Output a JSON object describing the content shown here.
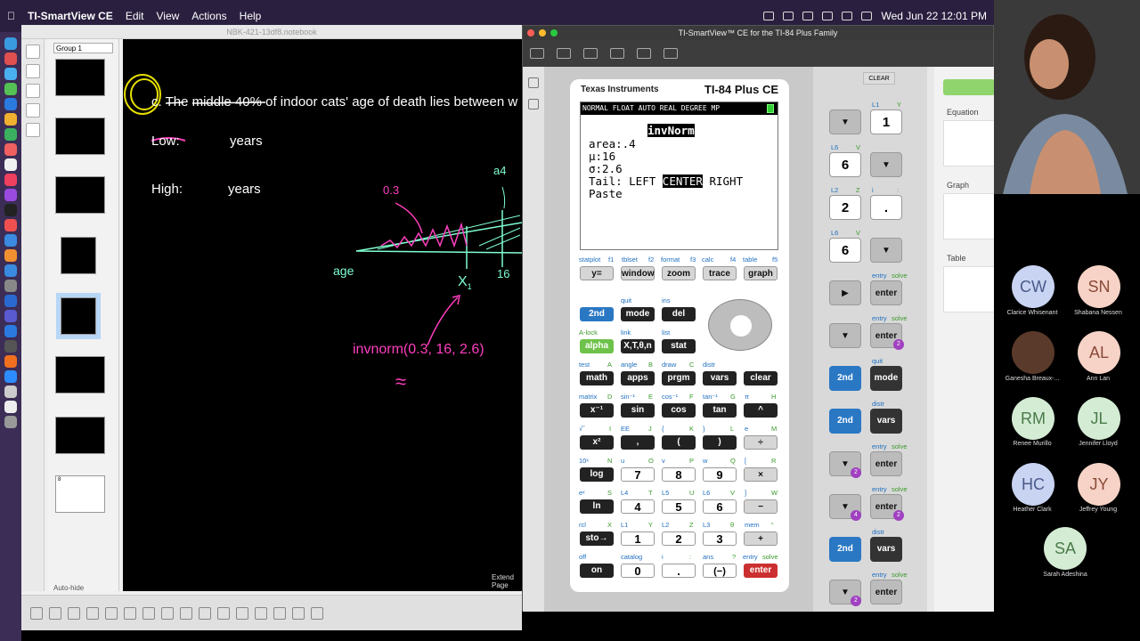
{
  "menubar": {
    "app_name": "TI-SmartView CE",
    "menus": [
      "Edit",
      "View",
      "Actions",
      "Help"
    ],
    "datetime": "Wed Jun 22  12:01 PM"
  },
  "notebook": {
    "title": "NBK-421-13df8.notebook",
    "group": "Group 1",
    "thumb_numbers": [
      "8"
    ],
    "auto_hide": "Auto-hide",
    "question": "c. The middle 40% of indoor cats' age of death lies between w",
    "low_label": "Low:",
    "high_label": "High:",
    "years": "years",
    "extend_page": "Extend Page",
    "handwriting": {
      "a03": "0.3",
      "a04": "a4",
      "age": "age",
      "x1": "X",
      "x1_sub": "1",
      "sixteen": "16",
      "invnorm": "invnorm(0.3, 16, 2.6)",
      "approx": "≈"
    }
  },
  "ti": {
    "window_title": "TI-SmartView™ CE for the TI-84 Plus Family",
    "brand": "Texas Instruments",
    "model": "TI-84 Plus CE",
    "status_bar": "NORMAL FLOAT AUTO REAL DEGREE MP",
    "screen": {
      "title": "invNorm",
      "area": "area:.4",
      "mu": "μ:16",
      "sigma": "σ:2.6",
      "tail_prefix": "Tail: LEFT ",
      "tail_center": "CENTER",
      "tail_suffix": " RIGHT",
      "paste": "Paste"
    },
    "function_labels": [
      "statplot",
      "f1",
      "tblset",
      "f2",
      "format",
      "f3",
      "calc",
      "f4",
      "table",
      "f5"
    ],
    "function_keys": [
      "y=",
      "window",
      "zoom",
      "trace",
      "graph"
    ],
    "key_labels": {
      "quit": "quit",
      "ins": "ins",
      "alock": "A-lock",
      "link": "link",
      "list": "list",
      "test": "test",
      "a": "A",
      "angle": "angle",
      "b": "B",
      "draw": "draw",
      "c": "C",
      "distr": "distr",
      "matrix": "matrix",
      "d": "D",
      "sininv": "sin⁻¹",
      "e": "E",
      "cosinv": "cos⁻¹",
      "f": "F",
      "taninv": "tan⁻¹",
      "g": "G",
      "pi": "π",
      "h": "H",
      "root": "√‾",
      "i": "I",
      "ee": "EE",
      "j": "J",
      "lbrace": "{",
      "k": "K",
      "rbrace": "}",
      "l": "L",
      "e_const": "e",
      "m": "M",
      "tenx": "10ˣ",
      "n": "N",
      "u": "u",
      "o": "O",
      "v": "v",
      "p": "P",
      "w": "w",
      "q": "Q",
      "lbrack": "[",
      "r": "R",
      "ex": "eˣ",
      "s": "S",
      "l4": "L4",
      "t": "T",
      "l5": "L5",
      "uu": "U",
      "l6": "L6",
      "vv": "V",
      "rbrack": "]",
      "ww": "W",
      "rcl": "rcl",
      "x": "X",
      "l1": "L1",
      "y": "Y",
      "l2": "L2",
      "z": "Z",
      "l3": "L3",
      "theta": "θ",
      "mem": "mem",
      "quote": "“",
      "off": "off",
      "catalog": "catalog",
      "ii": "i",
      "colon": ":",
      "ans": "ans",
      "qm": "?",
      "entry": "entry",
      "solve": "solve"
    },
    "keys": {
      "second": "2nd",
      "mode": "mode",
      "del": "del",
      "alpha": "alpha",
      "xttn": "X,T,θ,n",
      "stat": "stat",
      "math": "math",
      "apps": "apps",
      "prgm": "prgm",
      "vars": "vars",
      "clear": "clear",
      "xinv": "x⁻¹",
      "sin": "sin",
      "cos": "cos",
      "tan": "tan",
      "caret": "^",
      "xsq": "x²",
      "comma": ",",
      "lparen": "(",
      "rparen": ")",
      "div": "÷",
      "log": "log",
      "seven": "7",
      "eight": "8",
      "nine": "9",
      "mul": "×",
      "ln": "ln",
      "four": "4",
      "five": "5",
      "six": "6",
      "minus": "−",
      "sto": "sto→",
      "one": "1",
      "two": "2",
      "three": "3",
      "plus": "+",
      "on": "on",
      "zero": "0",
      "dot": ".",
      "neg": "(−)",
      "enter": "enter"
    },
    "history": {
      "clear": "CLEAR",
      "labels": {
        "l1": "L1",
        "y": "Y",
        "l6": "L6",
        "v": "V",
        "l2": "L2",
        "z": "Z",
        "i": "i",
        "colon": ":",
        "entry": "entry",
        "solve": "solve",
        "quit": "quit",
        "distr": "distr"
      },
      "keys": {
        "one": "1",
        "six": "6",
        "two": "2",
        "dot": ".",
        "enter": "enter",
        "second": "2nd",
        "mode": "mode",
        "vars": "vars"
      },
      "badges": {
        "b2": "2",
        "b4": "4"
      }
    },
    "right_panel": [
      "Equation",
      "Graph",
      "Table"
    ]
  },
  "participants": [
    {
      "initials": "CW",
      "name": "Clarice Whisenant",
      "color": "#c9d4f2"
    },
    {
      "initials": "SN",
      "name": "Shabana Nessen",
      "color": "#f6d3c6"
    },
    {
      "initials": "",
      "name": "Ganesha Breaux-...",
      "color": "#5a3a2a"
    },
    {
      "initials": "AL",
      "name": "Ann Lan",
      "color": "#f6d3c6"
    },
    {
      "initials": "RM",
      "name": "Renee Murillo",
      "color": "#d4ecd4"
    },
    {
      "initials": "JL",
      "name": "Jennifer Lloyd",
      "color": "#d4ecd4"
    },
    {
      "initials": "HC",
      "name": "Heather Clark",
      "color": "#c9d4f2"
    },
    {
      "initials": "JY",
      "name": "Jeffrey Young",
      "color": "#f6d3c6"
    },
    {
      "initials": "SA",
      "name": "Sarah Adeshina",
      "color": "#d4ecd4"
    }
  ]
}
